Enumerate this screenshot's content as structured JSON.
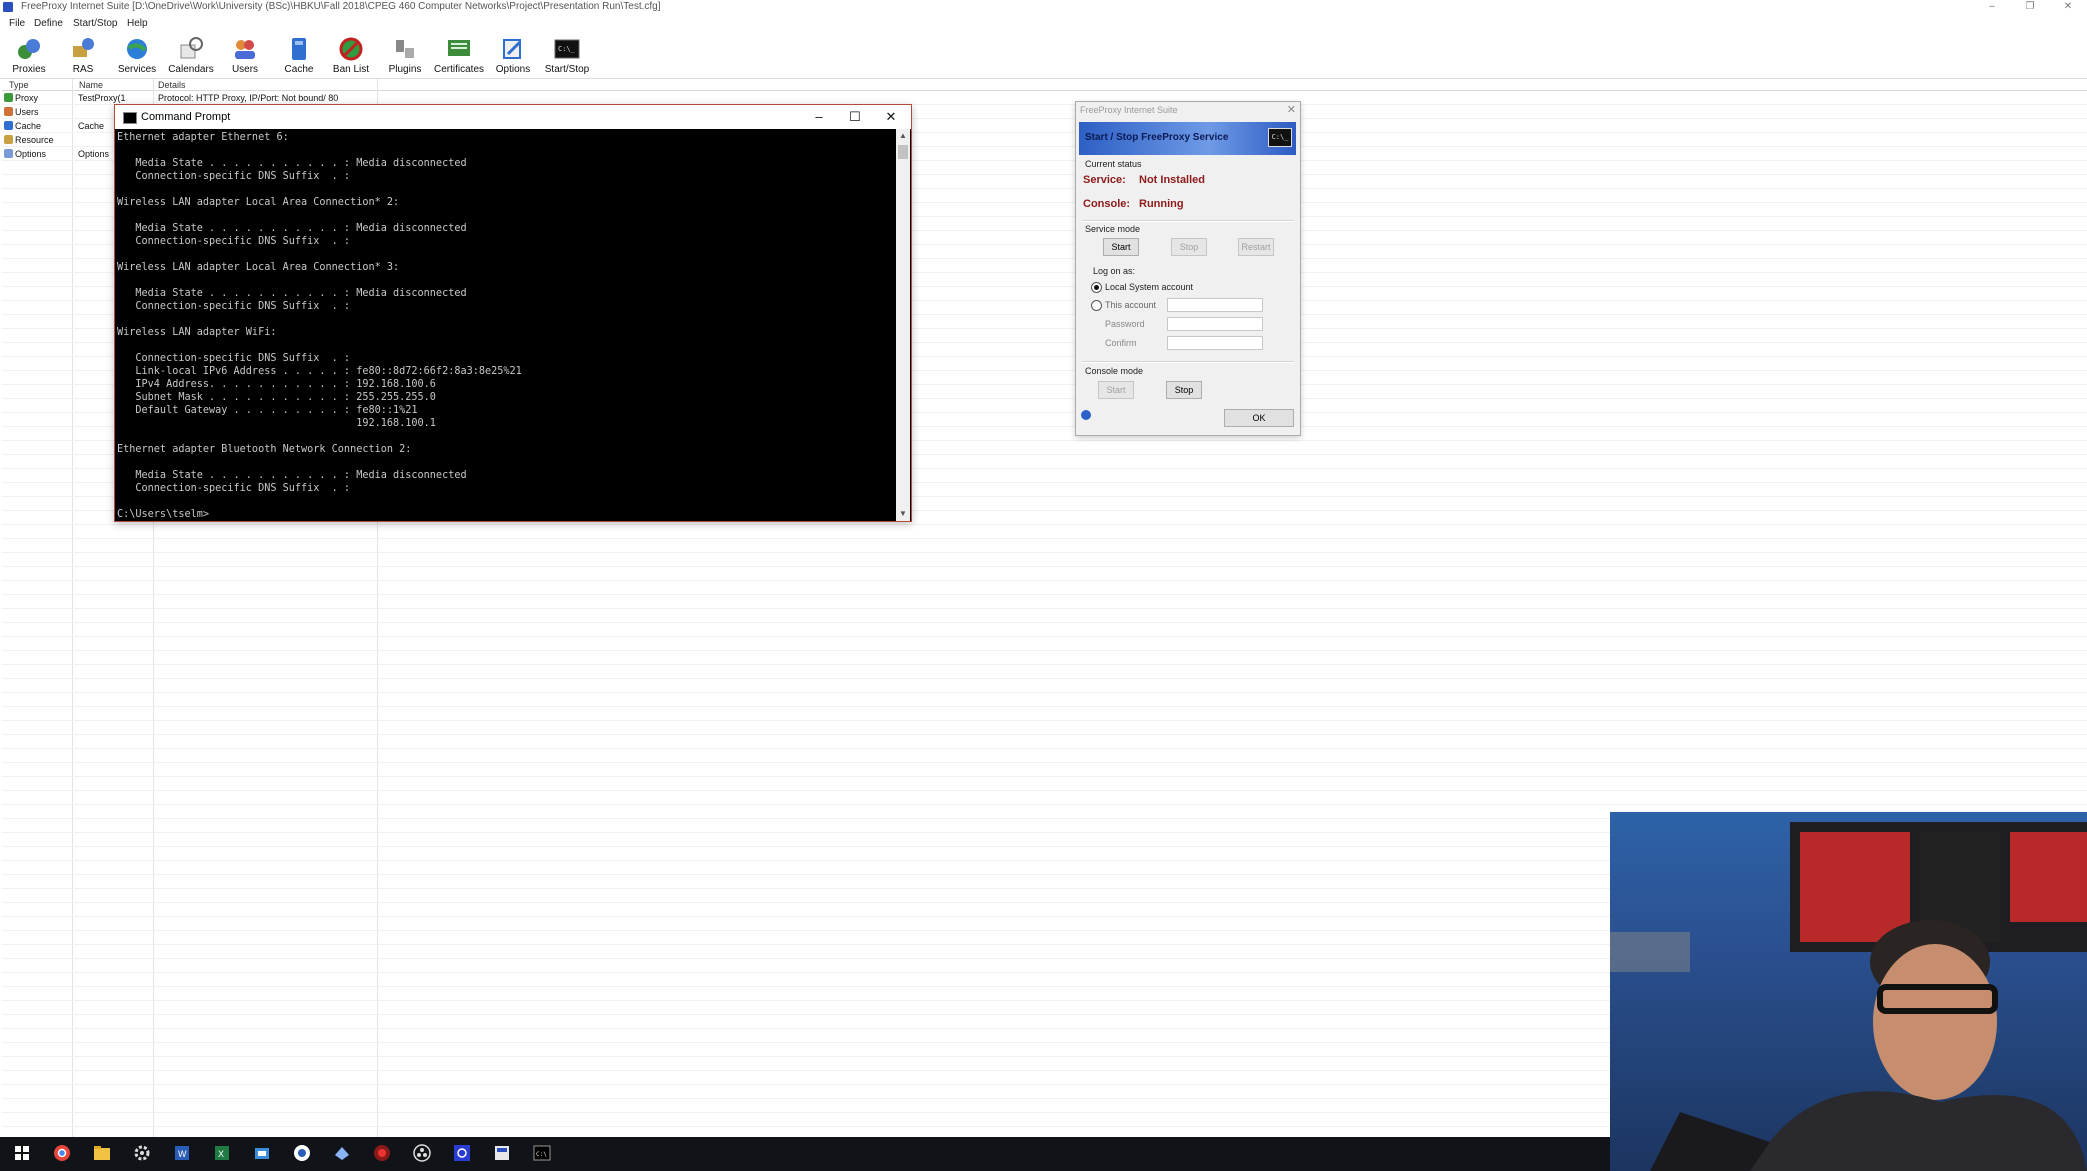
{
  "app": {
    "title": "FreeProxy Internet Suite [D:\\OneDrive\\Work\\University (BSc)\\HBKU\\Fall 2018\\CPEG 460 Computer Networks\\Project\\Presentation Run\\Test.cfg]",
    "window_controls": [
      "–",
      "❐",
      "✕"
    ]
  },
  "menu": [
    "File",
    "Define",
    "Start/Stop",
    "Help"
  ],
  "toolbar": [
    {
      "label": "Proxies",
      "icon": "proxies-icon"
    },
    {
      "label": "RAS",
      "icon": "ras-icon"
    },
    {
      "label": "Services",
      "icon": "services-icon"
    },
    {
      "label": "Calendars",
      "icon": "calendars-icon"
    },
    {
      "label": "Users",
      "icon": "users-icon"
    },
    {
      "label": "Cache",
      "icon": "cache-icon"
    },
    {
      "label": "Ban List",
      "icon": "ban-list-icon"
    },
    {
      "label": "Plugins",
      "icon": "plugins-icon"
    },
    {
      "label": "Certificates",
      "icon": "certificates-icon"
    },
    {
      "label": "Options",
      "icon": "options-icon"
    },
    {
      "label": "Start/Stop",
      "icon": "start-stop-icon"
    }
  ],
  "list": {
    "columns": [
      "Type",
      "Name",
      "Details"
    ],
    "tree": [
      "Proxy",
      "Users",
      "Cache",
      "Resource",
      "Options"
    ],
    "rows": [
      {
        "name": "TestProxy(1",
        "details": "Protocol: HTTP Proxy, IP/Port: Not bound/ 80"
      },
      {
        "name": "Cache",
        "details": ""
      },
      {
        "name": "Options",
        "details": ""
      }
    ]
  },
  "cmd": {
    "title": "Command Prompt",
    "output": "Ethernet adapter Ethernet 6:\n\n   Media State . . . . . . . . . . . : Media disconnected\n   Connection-specific DNS Suffix  . :\n\nWireless LAN adapter Local Area Connection* 2:\n\n   Media State . . . . . . . . . . . : Media disconnected\n   Connection-specific DNS Suffix  . :\n\nWireless LAN adapter Local Area Connection* 3:\n\n   Media State . . . . . . . . . . . : Media disconnected\n   Connection-specific DNS Suffix  . :\n\nWireless LAN adapter WiFi:\n\n   Connection-specific DNS Suffix  . :\n   Link-local IPv6 Address . . . . . : fe80::8d72:66f2:8a3:8e25%21\n   IPv4 Address. . . . . . . . . . . : 192.168.100.6\n   Subnet Mask . . . . . . . . . . . : 255.255.255.0\n   Default Gateway . . . . . . . . . : fe80::1%21\n                                       192.168.100.1\n\nEthernet adapter Bluetooth Network Connection 2:\n\n   Media State . . . . . . . . . . . : Media disconnected\n   Connection-specific DNS Suffix  . :\n\nC:\\Users\\tselm>"
  },
  "dialog": {
    "title": "FreeProxy Internet Suite",
    "banner": "Start / Stop FreeProxy Service",
    "current_status": "Current status",
    "service_label": "Service:",
    "service_value": "Not Installed",
    "console_label": "Console:",
    "console_value": "Running",
    "service_mode": "Service mode",
    "service_buttons": [
      "Start",
      "Stop",
      "Restart"
    ],
    "log_on_as": "Log on as:",
    "local_system": "Local System account",
    "this_account": "This account",
    "password": "Password",
    "confirm": "Confirm",
    "console_mode": "Console mode",
    "console_buttons": [
      "Start",
      "Stop"
    ],
    "ok": "OK"
  },
  "taskbar": [
    "windows-start-icon",
    "chrome-icon",
    "file-explorer-icon",
    "settings-icon",
    "word-icon",
    "excel-icon",
    "store-icon",
    "browser-icon",
    "steam-icon",
    "record-icon",
    "obs-icon",
    "network-app-icon",
    "freeproxy-icon",
    "command-prompt-icon"
  ],
  "colors": {
    "status_red": "#8e1a1a",
    "banner_blue": "#2e5fc4",
    "cmd_border": "#b44a3a"
  }
}
